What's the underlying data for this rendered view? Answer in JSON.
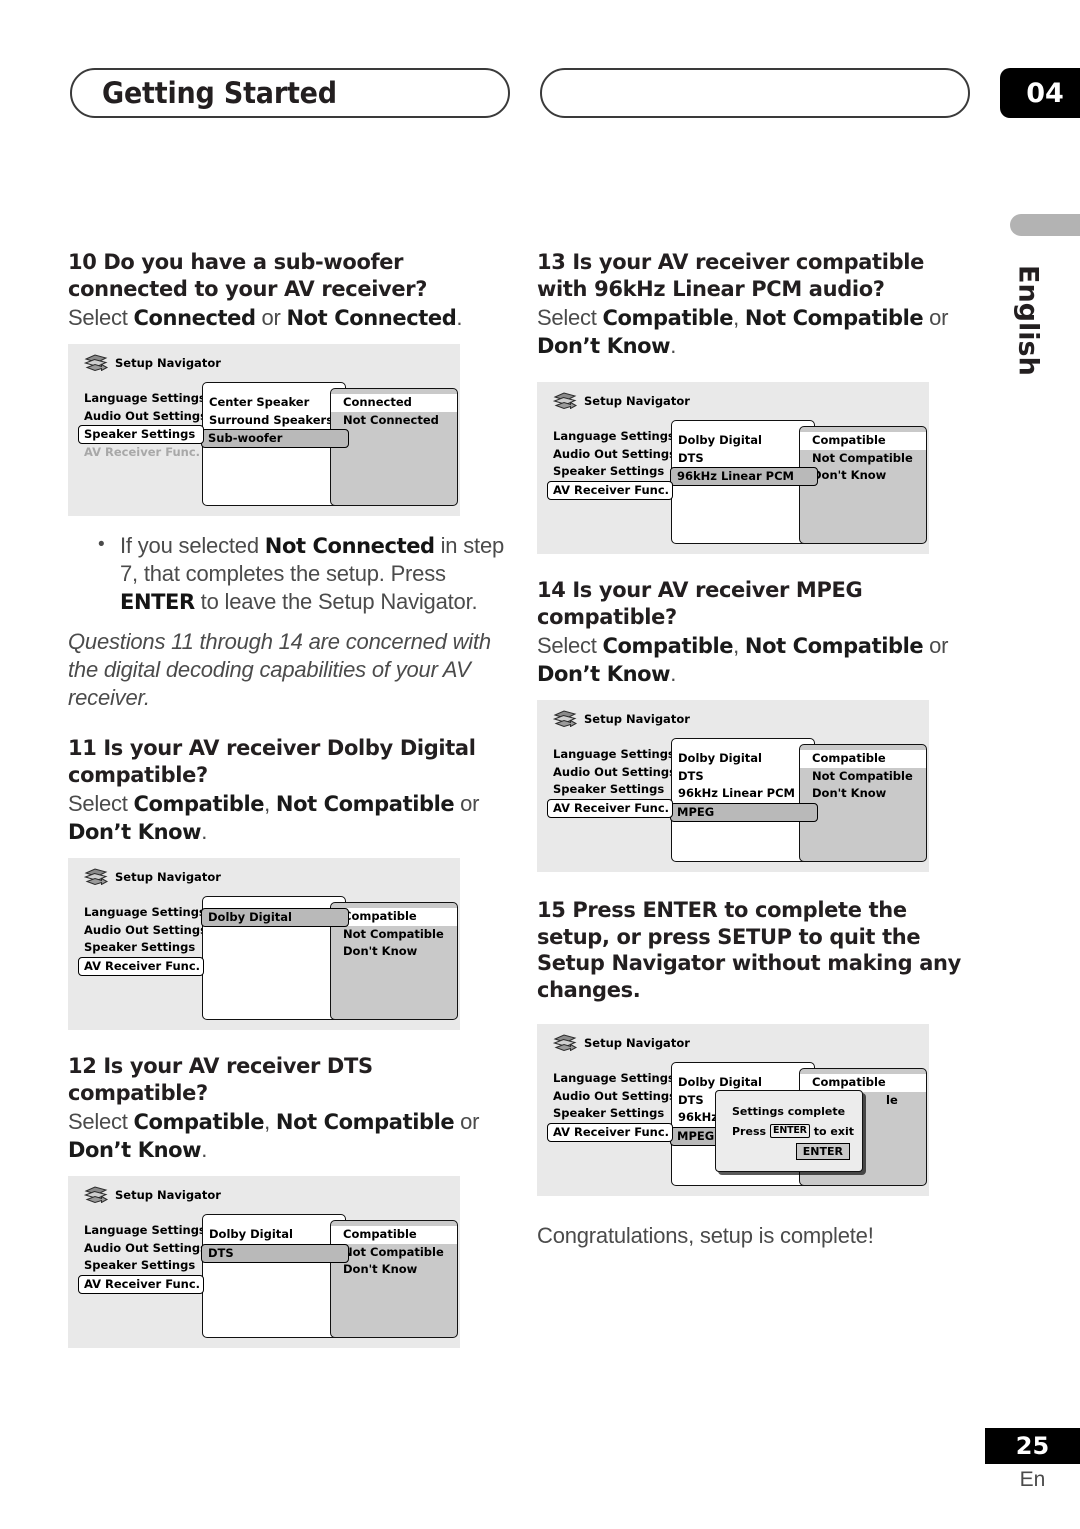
{
  "header": {
    "title": "Getting Started",
    "chapter": "04",
    "side_tab": "English"
  },
  "footer": {
    "page_number": "25",
    "language_code": "En"
  },
  "osd_common": {
    "window_title": "Setup Navigator",
    "icon": "setup-navigator-icon",
    "menu_items": [
      "Language Settings",
      "Audio Out Settings",
      "Speaker Settings",
      "AV Receiver Func."
    ]
  },
  "left_column": {
    "q10": {
      "number": "10",
      "title": "Do you have a sub-woofer connected to your AV receiver?",
      "select_prefix": "Select ",
      "option_a": "Connected",
      "joiner": " or ",
      "option_b": "Not Connected",
      "period": ".",
      "osd": {
        "selected_menu_index": 2,
        "dim_menu_index": 3,
        "mid_rows": [
          "Center Speaker",
          "Surround Speakers",
          "Sub-woofer"
        ],
        "mid_highlight_index": 2,
        "options": [
          "Connected",
          "Not Connected"
        ],
        "option_highlight_index": 0
      }
    },
    "bullet": {
      "text_1": "If you selected ",
      "bold_1": "Not Connected",
      "text_2": " in step 7, that completes the setup. Press ",
      "bold_2": "ENTER",
      "text_3": " to leave the Setup Navigator."
    },
    "note": "Questions 11 through 14 are concerned with the digital decoding capabilities of your AV receiver.",
    "q11": {
      "number": "11",
      "title": "Is your AV receiver Dolby Digital compatible?",
      "select_prefix": "Select ",
      "option_a": "Compatible",
      "comma": ", ",
      "option_b": "Not Compatible",
      "joiner": " or ",
      "option_c": "Don’t Know",
      "period": ".",
      "osd": {
        "selected_menu_index": 3,
        "dim_menu_index": -1,
        "mid_rows": [
          "Dolby Digital"
        ],
        "mid_highlight_index": 0,
        "options": [
          "Compatible",
          "Not Compatible",
          "Don't Know"
        ],
        "option_highlight_index": 0
      }
    },
    "q12": {
      "number": "12",
      "title": "Is your AV receiver DTS compatible?",
      "select_prefix": "Select ",
      "option_a": "Compatible",
      "comma": ", ",
      "option_b": "Not Compatible",
      "joiner": " or ",
      "option_c": "Don’t Know",
      "period": ".",
      "osd": {
        "selected_menu_index": 3,
        "dim_menu_index": -1,
        "mid_rows": [
          "Dolby Digital",
          "DTS"
        ],
        "mid_highlight_index": 1,
        "options": [
          "Compatible",
          "Not Compatible",
          "Don't Know"
        ],
        "option_highlight_index": 0
      }
    }
  },
  "right_column": {
    "q13": {
      "number": "13",
      "title": "Is your AV receiver compatible with 96kHz Linear PCM audio?",
      "select_prefix": "Select ",
      "option_a": "Compatible",
      "comma": ", ",
      "option_b": "Not Compatible",
      "joiner": " or ",
      "option_c": "Don’t Know",
      "period": ".",
      "osd": {
        "selected_menu_index": 3,
        "dim_menu_index": -1,
        "mid_rows": [
          "Dolby Digital",
          "DTS",
          "96kHz Linear PCM"
        ],
        "mid_highlight_index": 2,
        "options": [
          "Compatible",
          "Not Compatible",
          "Don't Know"
        ],
        "option_highlight_index": 0
      }
    },
    "q14": {
      "number": "14",
      "title": "Is your AV receiver MPEG compatible?",
      "select_prefix": "Select ",
      "option_a": "Compatible",
      "comma": ", ",
      "option_b": "Not Compatible",
      "joiner": " or ",
      "option_c": "Don’t Know",
      "period": ".",
      "osd": {
        "selected_menu_index": 3,
        "dim_menu_index": -1,
        "mid_rows": [
          "Dolby Digital",
          "DTS",
          "96kHz Linear PCM",
          "MPEG"
        ],
        "mid_highlight_index": 3,
        "options": [
          "Compatible",
          "Not Compatible",
          "Don't Know"
        ],
        "option_highlight_index": 0
      }
    },
    "q15": {
      "number": "15",
      "title": "Press ENTER to complete the setup, or press SETUP to quit the Setup Navigator without making any changes.",
      "osd": {
        "selected_menu_index": 3,
        "dim_menu_index": -1,
        "mid_rows": [
          "Dolby Digital",
          "DTS",
          "96kHz Li",
          "MPEG"
        ],
        "mid_highlight_index": 3,
        "options": [
          "Compatible",
          "le",
          ""
        ],
        "option_highlight_index": 0,
        "dialog": {
          "line1": "Settings complete",
          "line2_pre": "Press ",
          "line2_key": "ENTER",
          "line2_post": " to exit",
          "button": "ENTER"
        }
      }
    },
    "closing": "Congratulations, setup is complete!"
  }
}
